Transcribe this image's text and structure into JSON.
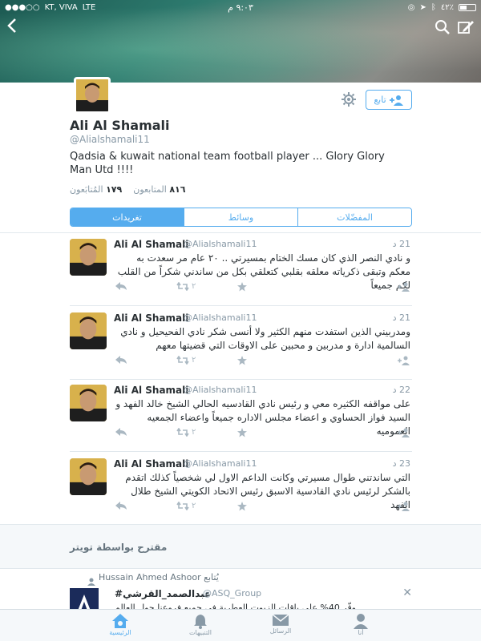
{
  "status_bar": {
    "carrier": "KT, VIVA",
    "network": "LTE",
    "time": "٩:٠٣ م",
    "battery": "٤٢٪"
  },
  "profile": {
    "name": "Ali Al Shamali",
    "handle": "@Alialshamali11",
    "bio": "Qadsia & kuwait national team football player ... Glory Glory Man Utd !!!!",
    "following_count": "١٧٩",
    "following_label": "المُتابَعون",
    "followers_count": "٨١٦",
    "followers_label": "المتابعون",
    "follow_button": "تابع"
  },
  "tabs": [
    {
      "label": "تغريدات",
      "active": true
    },
    {
      "label": "وسائط",
      "active": false
    },
    {
      "label": "المفضّلات",
      "active": false
    }
  ],
  "tweets": [
    {
      "author": "Ali Al Shamali",
      "handle": "@Alialshamali11",
      "time": "21 د",
      "text": "و نادي النصر الذي كان مسك الختام بمسيرتي .. ٢٠ عام مر سعدت به معكم وتبقى ذكرياته معلقه بقلبي كتعلقي بكل من ساندني شكراً من القلب لكم جميعاً",
      "retweets": "٢"
    },
    {
      "author": "Ali Al Shamali",
      "handle": "@Alialshamali11",
      "time": "21 د",
      "text": "ومدربيني الذين استفدت منهم الكثير ولا أنسى شكر نادي الفحيحيل و نادي السالمية ادارة و مدربين و محبين على الاوقات التي قضيتها معهم",
      "retweets": "٢"
    },
    {
      "author": "Ali Al Shamali",
      "handle": "@Alialshamali11",
      "time": "22 د",
      "text": "على مواقفه الكثيره معي و رئيس نادي القادسيه الحالي الشيخ خالد الفهد و السيد فواز الحساوي و اعضاء مجلس الاداره جميعاً واعضاء الجمعيه العموميه",
      "retweets": "٢"
    },
    {
      "author": "Ali Al Shamali",
      "handle": "@Alialshamali11",
      "time": "23 د",
      "text": "التي ساندتني طوال مسيرتي وكانت الداعم الاول لي شخصياً كذلك اتقدم بالشكر لرئيس نادي القادسية الاسبق رئيس الاتحاد الكويتي الشيخ طلال الفهد",
      "retweets": "٢"
    }
  ],
  "suggested": {
    "title": "مقترح بواسطة تويتر",
    "followed_by": "Hussain Ahmed Ashoor يُتابع",
    "name": "#عبدالصمد_القرشي",
    "handle": "@ASQ_Group",
    "text": "وفّر 40% على باقات الزيوت العطرية في جميع فروعنا حول العالم"
  },
  "bottom_nav": [
    {
      "label": "الرئيسية",
      "icon": "home-icon",
      "active": true
    },
    {
      "label": "التنبيهات",
      "icon": "bell-icon",
      "active": false
    },
    {
      "label": "الرسائل",
      "icon": "mail-icon",
      "active": false
    },
    {
      "label": "أنا",
      "icon": "person-icon",
      "active": false
    }
  ],
  "colors": {
    "accent": "#55acee",
    "text": "#292f33",
    "muted": "#8899a6"
  }
}
